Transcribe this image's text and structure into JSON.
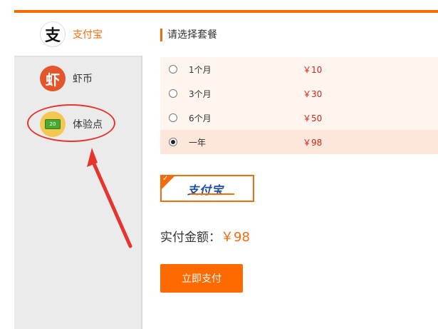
{
  "sidebar": {
    "items": [
      {
        "label": "支付宝",
        "icon": "alipay-logo-icon",
        "glyph": "支",
        "active": true,
        "color": "#f26c0c"
      },
      {
        "label": "虾币",
        "icon": "shrimp-coin-icon",
        "glyph": "虾",
        "active": false
      },
      {
        "label": "体验点",
        "icon": "experience-points-icon",
        "glyph": "20",
        "active": false
      }
    ]
  },
  "main": {
    "section_title": "请选择套餐",
    "plans": [
      {
        "name": "1个月",
        "price": "￥10",
        "selected": false
      },
      {
        "name": "3个月",
        "price": "￥30",
        "selected": false
      },
      {
        "name": "6个月",
        "price": "￥50",
        "selected": false
      },
      {
        "name": "一年",
        "price": "￥98",
        "selected": true
      }
    ],
    "payment_method": {
      "logo_text": "支付宝",
      "selected": true
    },
    "amount_label": "实付金额：",
    "amount_value": "￥98",
    "pay_button": "立即支付"
  },
  "colors": {
    "accent": "#f26c0c",
    "price": "#d0261a",
    "annotation": "#e5352e"
  }
}
